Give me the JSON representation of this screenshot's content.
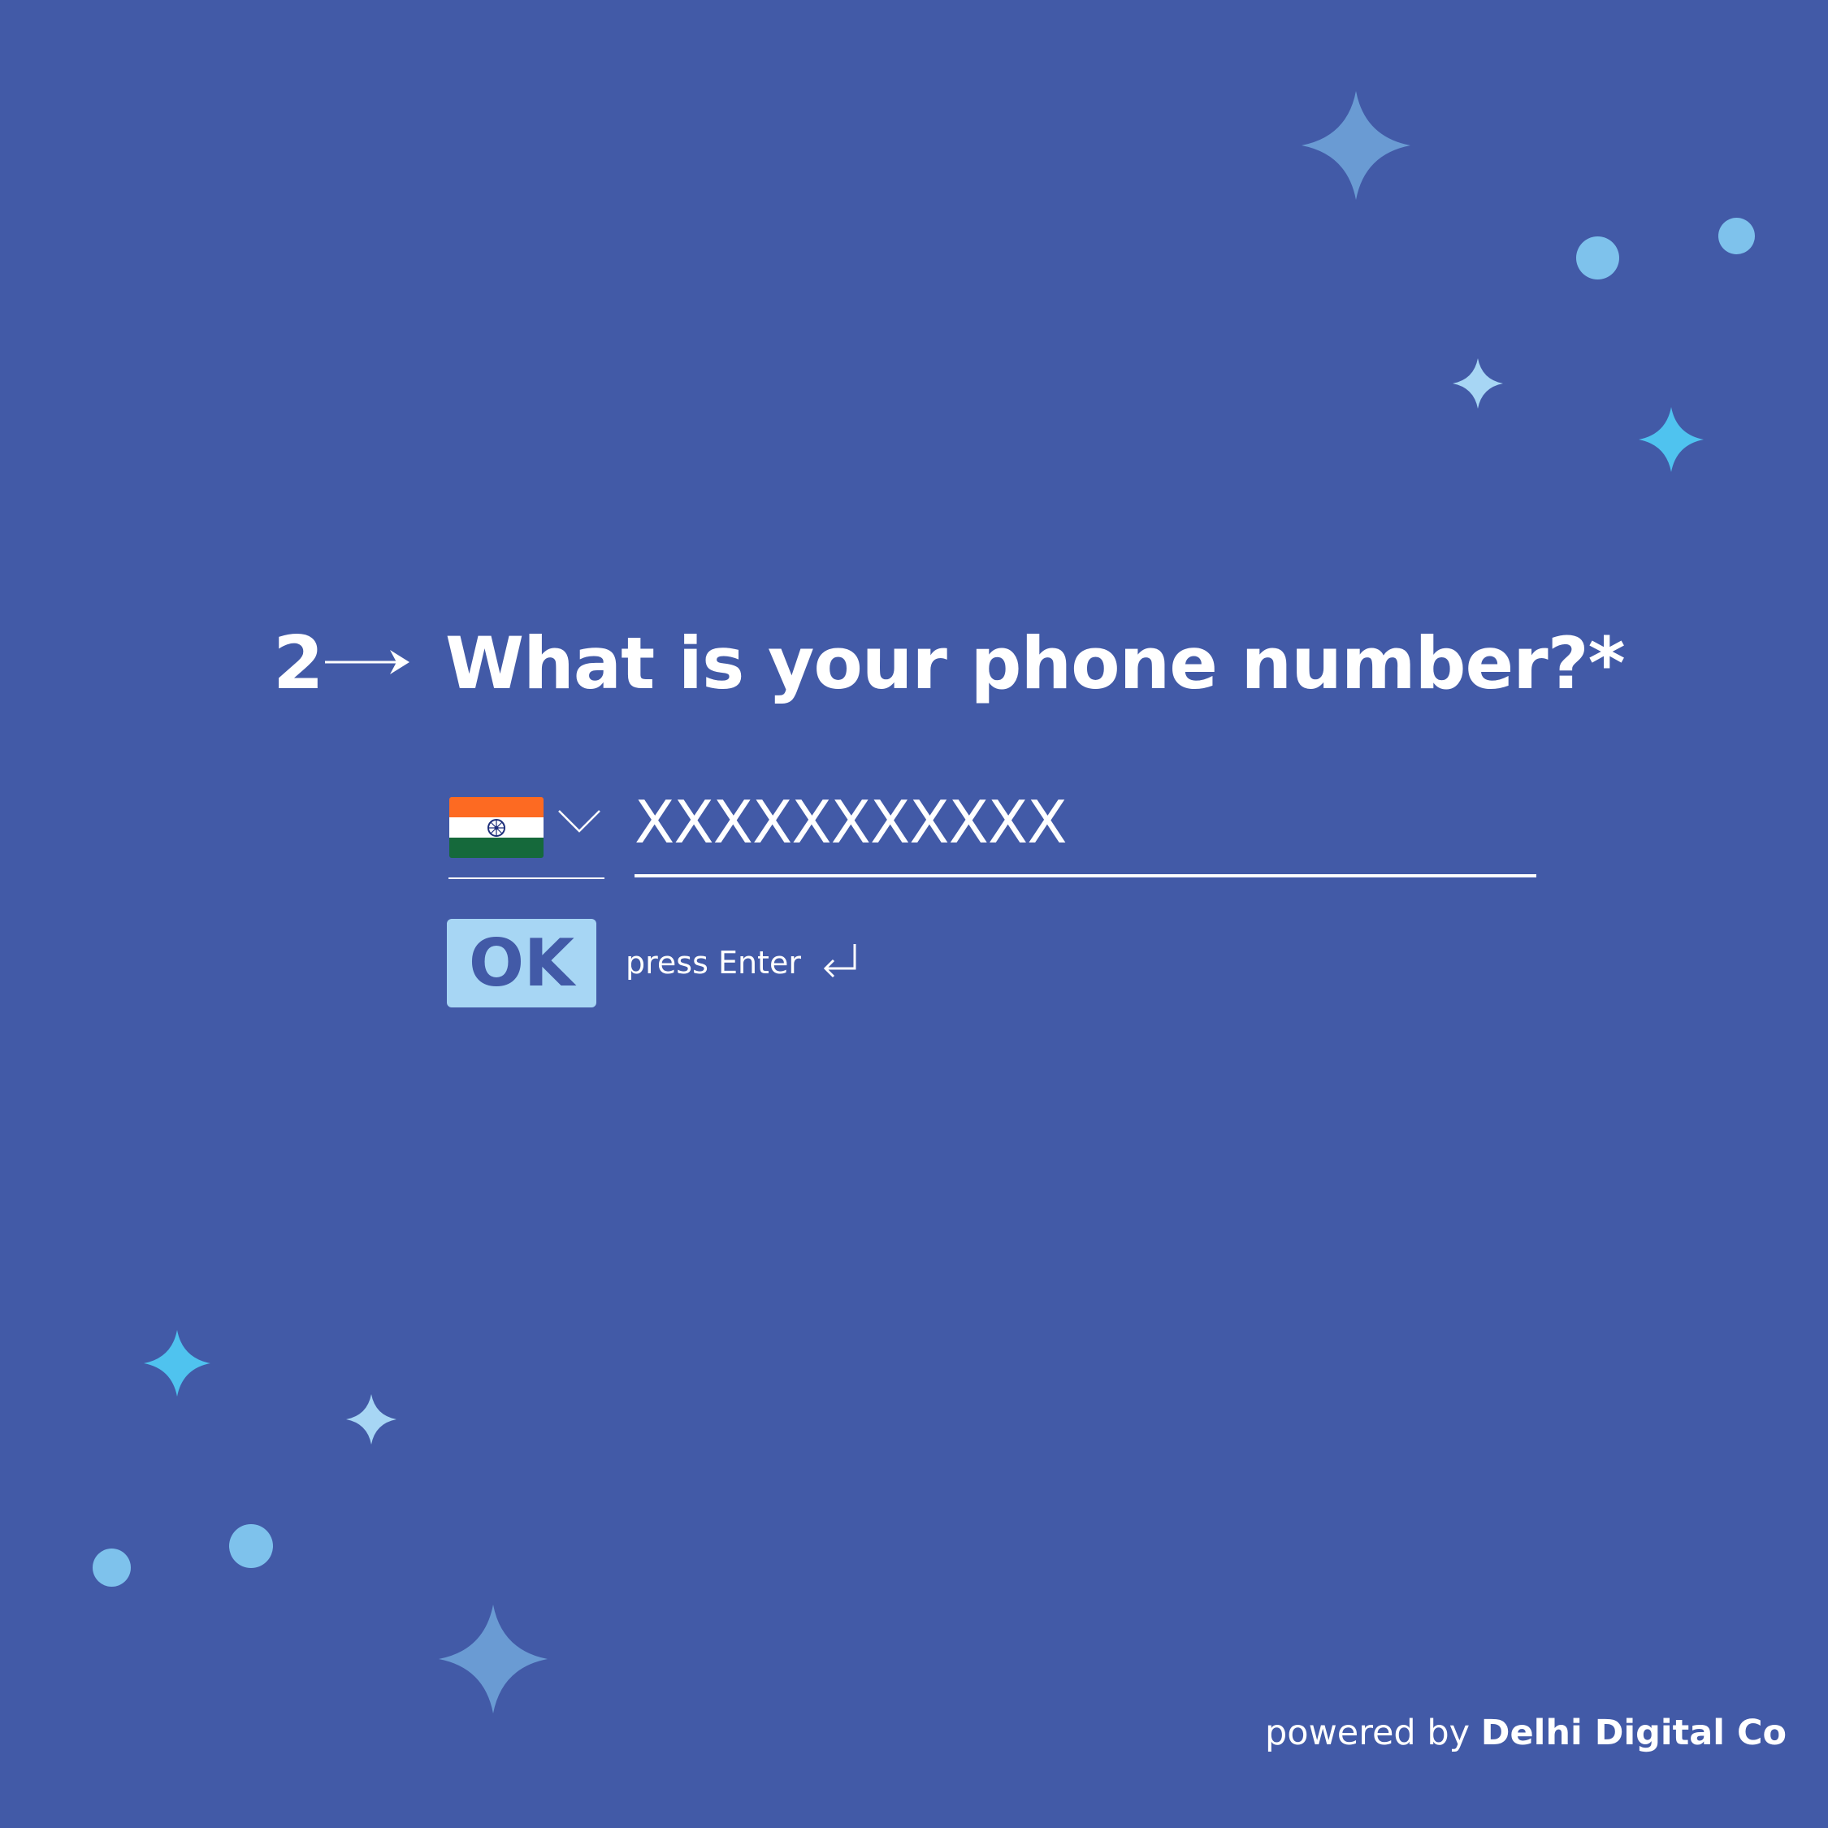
{
  "question": {
    "number": "2",
    "text": "What is your phone number?*"
  },
  "country_selector": {
    "flag": "india-flag-icon",
    "dropdown_icon": "chevron-down-icon"
  },
  "phone_input": {
    "value": "XXXXXXXXXXX"
  },
  "ok_button": {
    "label": "OK"
  },
  "hint": {
    "text": "press Enter",
    "icon": "enter-key-icon"
  },
  "footer": {
    "prefix": "powered by",
    "brand": "Delhi Digital Co"
  },
  "colors": {
    "background": "#425aa7",
    "ok_button_bg": "#a7d6f4",
    "sparkle_muted": "#6a9bd3",
    "sparkle_bright": "#4fc3ef",
    "sparkle_light": "#a7d6f4",
    "dot": "#7ec2ec"
  }
}
